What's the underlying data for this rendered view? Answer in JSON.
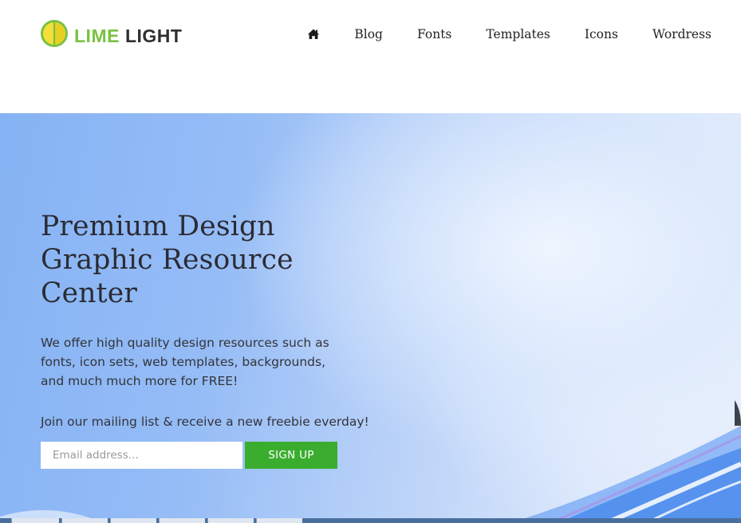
{
  "brand": {
    "word1": "LIME",
    "word2": "LIGHT",
    "colors": {
      "lime": "#7ac142",
      "dark": "#2f2f2f",
      "yellow": "#f4df3b"
    }
  },
  "nav": {
    "home_icon": "home-icon",
    "items": [
      {
        "label": "Blog"
      },
      {
        "label": "Fonts"
      },
      {
        "label": "Templates"
      },
      {
        "label": "Icons"
      },
      {
        "label": "Wordress"
      }
    ]
  },
  "hero": {
    "title": "Premium Design Graphic Resource Center",
    "description": "We offer high quality design resources such as fonts, icon sets, web templates, backgrounds, and much much more for FREE!",
    "cta": "Join our mailing list & receive a new freebie everday!",
    "email_placeholder": "Email address...",
    "signup_label": "SIGN UP",
    "colors": {
      "signup_button": "#3aad2e",
      "background": "#95bcf6"
    }
  }
}
